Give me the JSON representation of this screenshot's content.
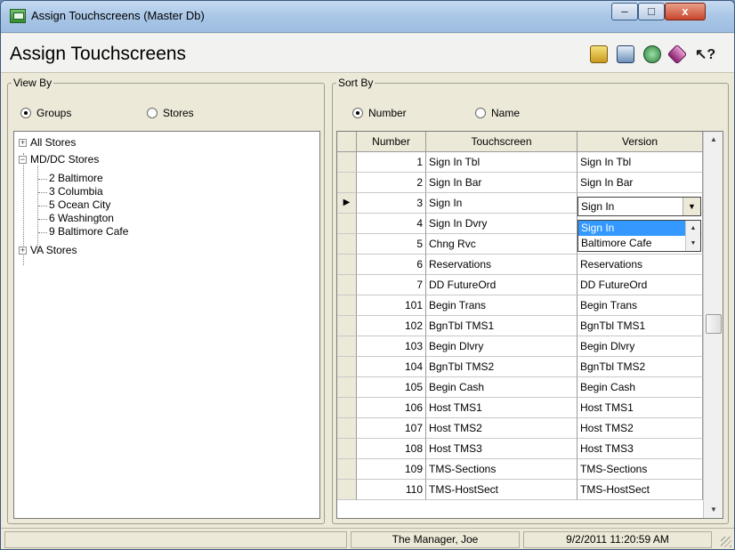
{
  "window": {
    "title": "Assign Touchscreens (Master Db)",
    "controls": {
      "minimize": "–",
      "maximize": "□",
      "close": "x"
    }
  },
  "header": {
    "title": "Assign Touchscreens",
    "toolbar_icons": [
      "edit-icon",
      "list-icon",
      "refresh-icon",
      "eraser-icon",
      "help-icon"
    ],
    "help_glyph": "↖?"
  },
  "view_by": {
    "label": "View By",
    "options": [
      {
        "label": "Groups",
        "selected": true
      },
      {
        "label": "Stores",
        "selected": false
      }
    ]
  },
  "sort_by": {
    "label": "Sort By",
    "options": [
      {
        "label": "Number",
        "selected": true
      },
      {
        "label": "Name",
        "selected": false
      }
    ]
  },
  "tree": {
    "items": [
      {
        "label": "All Stores",
        "expander": "+"
      },
      {
        "label": "MD/DC Stores",
        "expander": "−"
      },
      {
        "label": "2  Baltimore"
      },
      {
        "label": "3  Columbia"
      },
      {
        "label": "5  Ocean City"
      },
      {
        "label": "6  Washington"
      },
      {
        "label": "9  Baltimore Cafe"
      },
      {
        "label": "VA Stores",
        "expander": "+"
      }
    ]
  },
  "grid": {
    "columns": [
      "Number",
      "Touchscreen",
      "Version"
    ],
    "rows": [
      {
        "number": "1",
        "touchscreen": "Sign In Tbl",
        "version": "Sign In Tbl"
      },
      {
        "number": "2",
        "touchscreen": "Sign In Bar",
        "version": "Sign In Bar"
      },
      {
        "number": "3",
        "touchscreen": "Sign In",
        "version": "Sign In",
        "current": true
      },
      {
        "number": "4",
        "touchscreen": "Sign In Dvry",
        "version": ""
      },
      {
        "number": "5",
        "touchscreen": "Chng Rvc",
        "version": ""
      },
      {
        "number": "6",
        "touchscreen": "Reservations",
        "version": "Reservations"
      },
      {
        "number": "7",
        "touchscreen": "DD FutureOrd",
        "version": "DD FutureOrd"
      },
      {
        "number": "101",
        "touchscreen": "Begin Trans",
        "version": "Begin Trans"
      },
      {
        "number": "102",
        "touchscreen": "BgnTbl TMS1",
        "version": "BgnTbl TMS1"
      },
      {
        "number": "103",
        "touchscreen": "Begin Dlvry",
        "version": "Begin Dlvry"
      },
      {
        "number": "104",
        "touchscreen": "BgnTbl TMS2",
        "version": "BgnTbl TMS2"
      },
      {
        "number": "105",
        "touchscreen": "Begin Cash",
        "version": "Begin Cash"
      },
      {
        "number": "106",
        "touchscreen": "Host TMS1",
        "version": "Host TMS1"
      },
      {
        "number": "107",
        "touchscreen": "Host TMS2",
        "version": "Host TMS2"
      },
      {
        "number": "108",
        "touchscreen": "Host TMS3",
        "version": "Host TMS3"
      },
      {
        "number": "109",
        "touchscreen": "TMS-Sections",
        "version": "TMS-Sections"
      },
      {
        "number": "110",
        "touchscreen": "TMS-HostSect",
        "version": "TMS-HostSect"
      }
    ],
    "current_row_marker": "▶",
    "version_combo": {
      "value": "Sign In",
      "options": [
        "Sign In",
        "Baltimore Cafe"
      ],
      "highlighted": "Sign In"
    }
  },
  "status": {
    "user": "The Manager, Joe",
    "datetime": "9/2/2011 11:20:59 AM"
  },
  "colors": {
    "window_bg": "#ece9d8",
    "selection": "#3399ff",
    "titlebar": "#a9c6e6"
  }
}
